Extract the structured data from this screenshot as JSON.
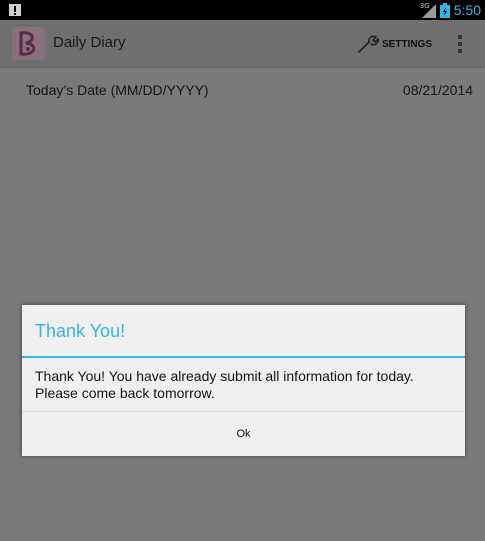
{
  "status_bar": {
    "time": "5:50",
    "network_type": "3G",
    "notification_icon": "alert-icon",
    "signal_icon": "signal-icon",
    "battery_icon": "battery-charging-icon"
  },
  "action_bar": {
    "app_icon": "app-logo-icon",
    "title": "Daily Diary",
    "settings_label": "SETTINGS",
    "settings_icon": "wrench-icon",
    "overflow_icon": "overflow-menu-icon"
  },
  "content": {
    "date_label": "Today’s Date (MM/DD/YYYY)",
    "date_value": "08/21/2014"
  },
  "dialog": {
    "title": "Thank You!",
    "message": "Thank You! You have already submit all information for today. Please come back tomorrow.",
    "ok_label": "Ok"
  },
  "colors": {
    "accent": "#33b5e5",
    "dim_overlay": "#7a7a7a",
    "dialog_bg": "#efefef"
  }
}
